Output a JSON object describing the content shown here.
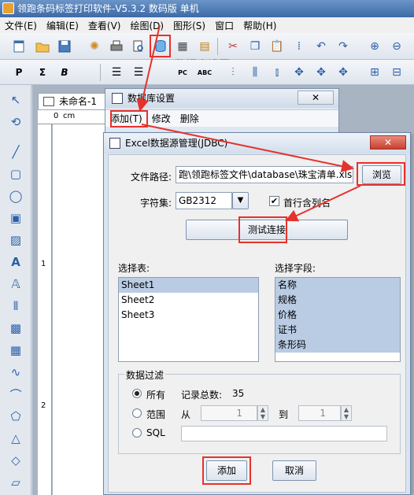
{
  "app": {
    "title": "领跑条码标签打印软件-V5.3.2 数码版 单机"
  },
  "menu": [
    "文件(E)",
    "编辑(E)",
    "查看(V)",
    "绘图(D)",
    "图形(S)",
    "窗口",
    "帮助(H)"
  ],
  "toolbar1": [
    "new-doc-icon",
    "open-folder-icon",
    "save-icon",
    "settings-gear-icon",
    "print-icon",
    "print-preview-icon",
    "database-icon",
    "grid-icon",
    "calculator-icon",
    "cut-icon",
    "copy-icon",
    "paste-icon",
    "align-icon",
    "undo-icon",
    "redo-icon",
    "zoom-in-icon",
    "zoom-out-icon"
  ],
  "toolbar2": {
    "labels": [
      "P",
      "Σ",
      "B",
      "PC",
      "ABC"
    ],
    "icons": [
      "text-P-icon",
      "sum-icon",
      "bold-icon",
      "align-left-icon",
      "align-center-icon",
      "align-right-icon",
      "pc-icon",
      "abc-icon"
    ]
  },
  "annotation": "数据库设置",
  "document": {
    "tab_label": "未命名-1",
    "ruler_marks": [
      "0",
      "cm",
      "1",
      "2"
    ]
  },
  "db_dialog": {
    "title": "数据库设置",
    "close_label": "✕",
    "menu": [
      "添加(T)",
      "修改",
      "删除"
    ]
  },
  "jdbc_dialog": {
    "title": "Excel数据源管理(JDBC)",
    "close_label": "✕",
    "file_path_label": "文件路径:",
    "file_path_value": "跑\\领跑标签文件\\database\\珠宝清单.xls",
    "browse_label": "浏览",
    "charset_label": "字符集:",
    "charset_value": "GB2312",
    "first_row_label": "首行含列名",
    "first_row_checked": true,
    "test_connection_label": "测试连接",
    "tables_label": "选择表:",
    "tables": [
      "Sheet1",
      "Sheet2",
      "Sheet3"
    ],
    "selected_table": "Sheet1",
    "fields_label": "选择字段:",
    "fields": [
      "名称",
      "规格",
      "价格",
      "证书",
      "条形码"
    ],
    "filter_group_label": "数据过滤",
    "filter_all_label": "所有",
    "record_total_label": "记录总数:",
    "record_total_value": "35",
    "filter_range_label": "范围",
    "from_label": "从",
    "from_value": "1",
    "to_label": "到",
    "to_value": "1",
    "filter_sql_label": "SQL",
    "sql_value": "",
    "add_label": "添加",
    "cancel_label": "取消"
  },
  "colors": {
    "highlight": "#e6322c",
    "title_bar": "#3d6aa6",
    "selection": "#b9cce4"
  }
}
